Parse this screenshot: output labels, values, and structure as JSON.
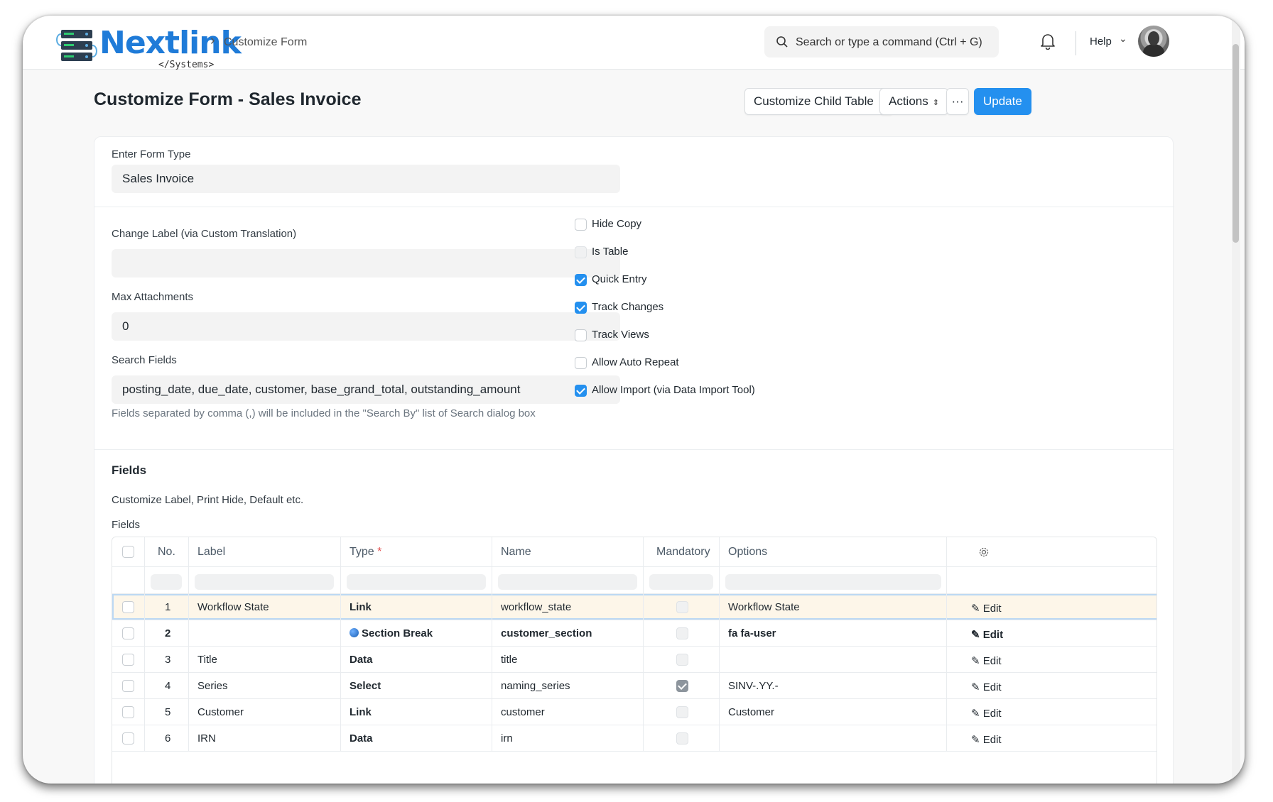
{
  "app": {
    "logo_text": "Nextlink",
    "logo_sub": "</Systems>",
    "breadcrumb": "Customize Form",
    "search_placeholder": "Search or type a command (Ctrl + G)",
    "help_label": "Help"
  },
  "page": {
    "title": "Customize Form - Sales Invoice",
    "buttons": {
      "child_table": "Customize Child Table",
      "actions": "Actions",
      "more": "···",
      "update": "Update"
    }
  },
  "form": {
    "form_type_label": "Enter Form Type",
    "form_type_value": "Sales Invoice",
    "change_label_label": "Change Label (via Custom Translation)",
    "change_label_value": "",
    "max_attachments_label": "Max Attachments",
    "max_attachments_value": "0",
    "search_fields_label": "Search Fields",
    "search_fields_value": "posting_date, due_date, customer, base_grand_total, outstanding_amount",
    "search_fields_hint": "Fields separated by comma (,) will be included in the \"Search By\" list of Search dialog box",
    "checkboxes": [
      {
        "label": "Hide Copy",
        "state": "off"
      },
      {
        "label": "Is Table",
        "state": "disabled"
      },
      {
        "label": "Quick Entry",
        "state": "on"
      },
      {
        "label": "Track Changes",
        "state": "on"
      },
      {
        "label": "Track Views",
        "state": "off"
      },
      {
        "label": "Allow Auto Repeat",
        "state": "off"
      },
      {
        "label": "Allow Import (via Data Import Tool)",
        "state": "on"
      }
    ]
  },
  "fields_section": {
    "title": "Fields",
    "subtitle": "Customize Label, Print Hide, Default etc.",
    "table_label": "Fields",
    "columns": [
      "No.",
      "Label",
      "Type",
      "Name",
      "Mandatory",
      "Options"
    ],
    "required_mark": "*",
    "edit_label": "Edit",
    "rows": [
      {
        "no": "1",
        "label": "Workflow State",
        "type": "Link",
        "name": "workflow_state",
        "mandatory": false,
        "options": "Workflow State",
        "bold": false,
        "active": true
      },
      {
        "no": "2",
        "label": "",
        "type": "Section Break",
        "name": "customer_section",
        "mandatory": false,
        "options": "fa fa-user",
        "bold": true,
        "active": false
      },
      {
        "no": "3",
        "label": "Title",
        "type": "Data",
        "name": "title",
        "mandatory": false,
        "options": "",
        "bold": false,
        "active": false
      },
      {
        "no": "4",
        "label": "Series",
        "type": "Select",
        "name": "naming_series",
        "mandatory": true,
        "options": "SINV-.YY.-",
        "bold": false,
        "active": false
      },
      {
        "no": "5",
        "label": "Customer",
        "type": "Link",
        "name": "customer",
        "mandatory": false,
        "options": "Customer",
        "bold": false,
        "active": false
      },
      {
        "no": "6",
        "label": "IRN",
        "type": "Data",
        "name": "irn",
        "mandatory": false,
        "options": "",
        "bold": false,
        "active": false
      }
    ]
  }
}
